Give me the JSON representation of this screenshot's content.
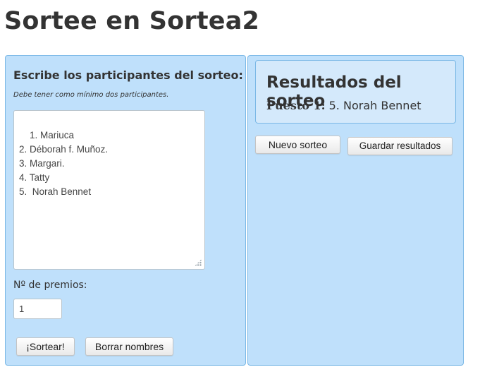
{
  "header": {
    "title": "Sortee en Sortea2"
  },
  "form": {
    "heading": "Escribe los participantes del sorteo:",
    "note": "Debe tener como mínimo dos participantes.",
    "participants_text": "1. Mariuca\n2. Déborah f. Muñoz.\n3. Margari.\n4. Tatty\n5.  Norah Bennet",
    "prizes_label": "Nº de premios:",
    "prizes_value": "1",
    "draw_button": "¡Sortear!",
    "clear_button": "Borrar nombres"
  },
  "results": {
    "title": "Resultados del sorteo",
    "place_label": "Puesto 1:",
    "place_value": "5. Norah Bennet",
    "new_button": "Nuevo sorteo",
    "save_button": "Guardar resultados"
  },
  "colors": {
    "panel_background": "#bfe0fb",
    "panel_border": "#7ab8e6",
    "results_background": "#d4e9fb"
  }
}
